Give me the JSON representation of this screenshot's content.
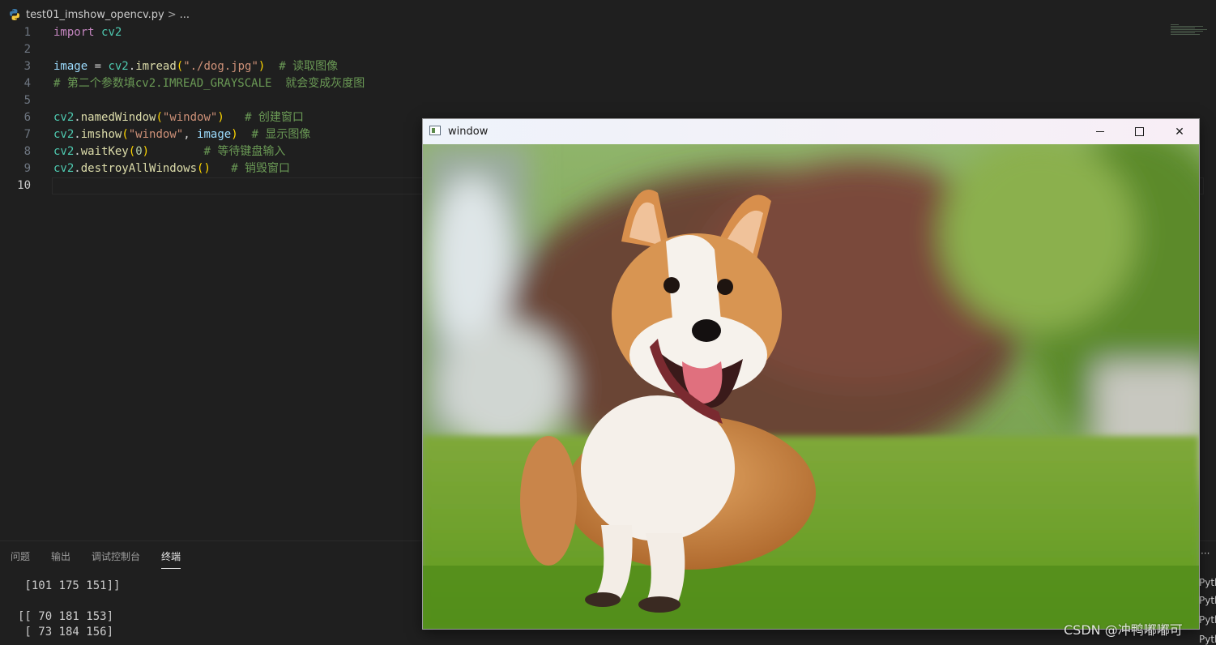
{
  "breadcrumb": {
    "file": "test01_imshow_opencv.py",
    "separator": ">",
    "more": "..."
  },
  "editor": {
    "active_line": "10",
    "lines": [
      {
        "n": "1",
        "tokens": [
          [
            "kw",
            "import"
          ],
          [
            "op",
            " "
          ],
          [
            "mod",
            "cv2"
          ]
        ]
      },
      {
        "n": "2",
        "tokens": []
      },
      {
        "n": "3",
        "tokens": [
          [
            "var",
            "image"
          ],
          [
            "op",
            " = "
          ],
          [
            "mod",
            "cv2"
          ],
          [
            "op",
            "."
          ],
          [
            "fn",
            "imread"
          ],
          [
            "p1",
            "("
          ],
          [
            "str",
            "\"./dog.jpg\""
          ],
          [
            "p1",
            ")"
          ],
          [
            "op",
            "  "
          ],
          [
            "cm",
            "# 读取图像"
          ]
        ]
      },
      {
        "n": "4",
        "tokens": [
          [
            "cm",
            "# 第二个参数填cv2.IMREAD_GRAYSCALE  就会变成灰度图"
          ]
        ]
      },
      {
        "n": "5",
        "tokens": []
      },
      {
        "n": "6",
        "tokens": [
          [
            "mod",
            "cv2"
          ],
          [
            "op",
            "."
          ],
          [
            "fn",
            "namedWindow"
          ],
          [
            "p1",
            "("
          ],
          [
            "str",
            "\"window\""
          ],
          [
            "p1",
            ")"
          ],
          [
            "op",
            "   "
          ],
          [
            "cm",
            "# 创建窗口"
          ]
        ]
      },
      {
        "n": "7",
        "tokens": [
          [
            "mod",
            "cv2"
          ],
          [
            "op",
            "."
          ],
          [
            "fn",
            "imshow"
          ],
          [
            "p1",
            "("
          ],
          [
            "str",
            "\"window\""
          ],
          [
            "op",
            ", "
          ],
          [
            "var",
            "image"
          ],
          [
            "p1",
            ")"
          ],
          [
            "op",
            "  "
          ],
          [
            "cm",
            "# 显示图像"
          ]
        ]
      },
      {
        "n": "8",
        "tokens": [
          [
            "mod",
            "cv2"
          ],
          [
            "op",
            "."
          ],
          [
            "fn",
            "waitKey"
          ],
          [
            "p1",
            "("
          ],
          [
            "num",
            "0"
          ],
          [
            "p1",
            ")"
          ],
          [
            "op",
            "        "
          ],
          [
            "cm",
            "# 等待键盘输入"
          ]
        ]
      },
      {
        "n": "9",
        "tokens": [
          [
            "mod",
            "cv2"
          ],
          [
            "op",
            "."
          ],
          [
            "fn",
            "destroyAllWindows"
          ],
          [
            "p1",
            "()"
          ],
          [
            "op",
            "   "
          ],
          [
            "cm",
            "# 销毁窗口"
          ]
        ]
      },
      {
        "n": "10",
        "tokens": []
      }
    ]
  },
  "panel": {
    "tabs": [
      {
        "label": "问题",
        "active": false
      },
      {
        "label": "输出",
        "active": false
      },
      {
        "label": "调试控制台",
        "active": false
      },
      {
        "label": "终端",
        "active": true
      }
    ],
    "terminal_lines": [
      " [101 175 151]]",
      "",
      "[[ 70 181 153]",
      " [ 73 184 156]"
    ],
    "side_more": "···",
    "side_items": [
      "Pyth",
      "Pyth",
      "Pyth",
      "Pyth"
    ]
  },
  "cv_window": {
    "title": "window",
    "minimize_symbol": "",
    "close_symbol": "✕"
  },
  "watermark": "CSDN @冲鸭嘟嘟可"
}
